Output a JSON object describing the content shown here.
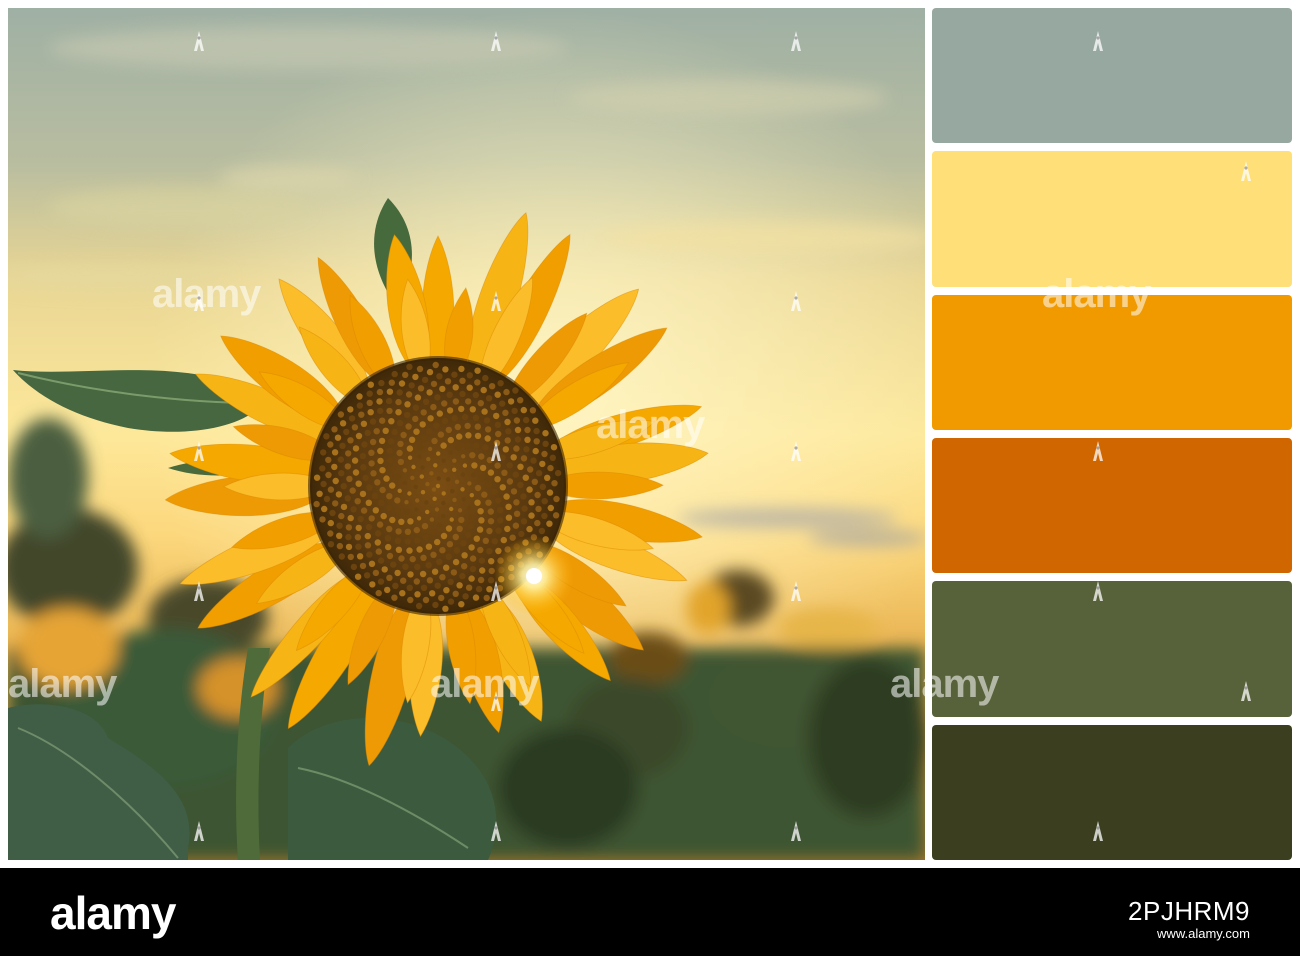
{
  "image": {
    "subject": "sunflower-at-sunset"
  },
  "palette": {
    "swatches": [
      {
        "color": "#97a8a0"
      },
      {
        "color": "#ffdf77"
      },
      {
        "color": "#f09a00"
      },
      {
        "color": "#d06600"
      },
      {
        "color": "#57623a"
      },
      {
        "color": "#3b3f20"
      }
    ]
  },
  "watermark": {
    "word": "alamy"
  },
  "footer": {
    "brand": "alamy",
    "image_id": "2PJHRM9",
    "url": "www.alamy.com"
  }
}
